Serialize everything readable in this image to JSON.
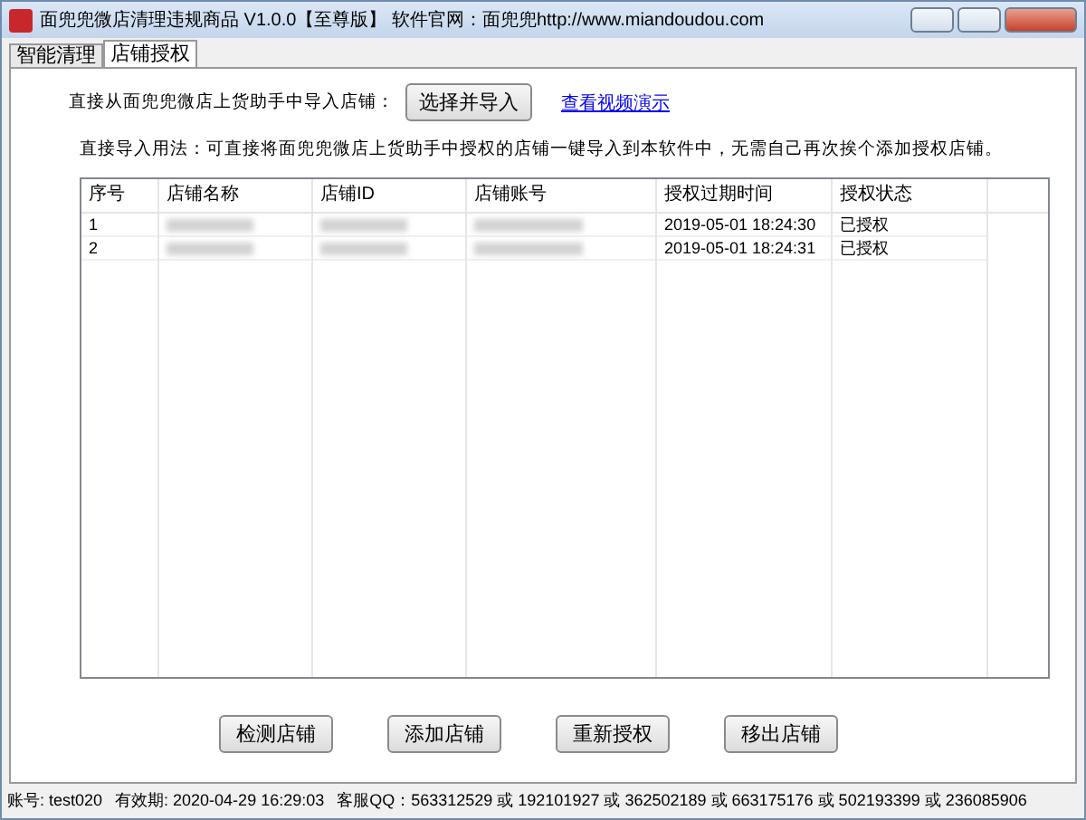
{
  "window": {
    "title": "面兜兜微店清理违规商品 V1.0.0【至尊版】 软件官网：面兜兜http://www.miandoudou.com"
  },
  "tabs": [
    {
      "label": "智能清理",
      "selected": false
    },
    {
      "label": "店铺授权",
      "selected": true
    }
  ],
  "import_row": {
    "label": "直接从面兜兜微店上货助手中导入店铺：",
    "button": "选择并导入",
    "link": "查看视频演示"
  },
  "hint": "直接导入用法：可直接将面兜兜微店上货助手中授权的店铺一键导入到本软件中，无需自己再次挨个添加授权店铺。",
  "table": {
    "columns": [
      "序号",
      "店铺名称",
      "店铺ID",
      "店铺账号",
      "授权过期时间",
      "授权状态"
    ],
    "rows": [
      {
        "index": "1",
        "expires": "2019-05-01 18:24:30",
        "status": "已授权"
      },
      {
        "index": "2",
        "expires": "2019-05-01 18:24:31",
        "status": "已授权"
      }
    ]
  },
  "buttons": [
    "检测店铺",
    "添加店铺",
    "重新授权",
    "移出店铺"
  ],
  "status_bar": {
    "account": "账号: test020",
    "expiry": "有效期: 2020-04-29 16:29:03",
    "support": "客服QQ：563312529 或 192101927 或 362502189 或 663175176 或 502193399 或 236085906"
  }
}
